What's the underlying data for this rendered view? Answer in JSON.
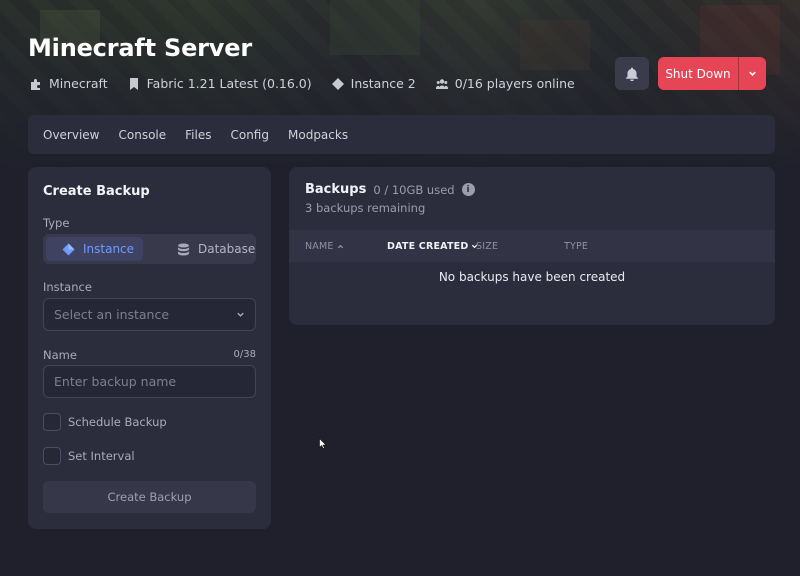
{
  "header": {
    "title": "Minecraft Server",
    "meta": {
      "game": "Minecraft",
      "version": "Fabric 1.21 Latest (0.16.0)",
      "instance": "Instance 2",
      "players": "0/16 players online"
    },
    "shutdown_label": "Shut Down"
  },
  "nav": {
    "tabs": [
      "Overview",
      "Console",
      "Files",
      "Config",
      "Modpacks"
    ]
  },
  "create_backup": {
    "title": "Create Backup",
    "type_label": "Type",
    "type_options": [
      "Instance",
      "Database"
    ],
    "selected_type": "Instance",
    "instance_label": "Instance",
    "instance_placeholder": "Select an instance",
    "name_label": "Name",
    "name_counter": "0/38",
    "name_placeholder": "Enter backup name",
    "schedule_label": "Schedule Backup",
    "interval_label": "Set Interval",
    "submit_label": "Create Backup"
  },
  "backups": {
    "title": "Backups",
    "usage": "0 / 10GB used",
    "remaining": "3 backups remaining",
    "columns": [
      "NAME",
      "DATE CREATED",
      "SIZE",
      "TYPE"
    ],
    "sorted_column": "DATE CREATED",
    "empty_text": "No backups have been created"
  },
  "colors": {
    "accent": "#6f9cff",
    "danger": "#e64556",
    "surface": "#2c2d3c",
    "background": "#1f202b"
  }
}
